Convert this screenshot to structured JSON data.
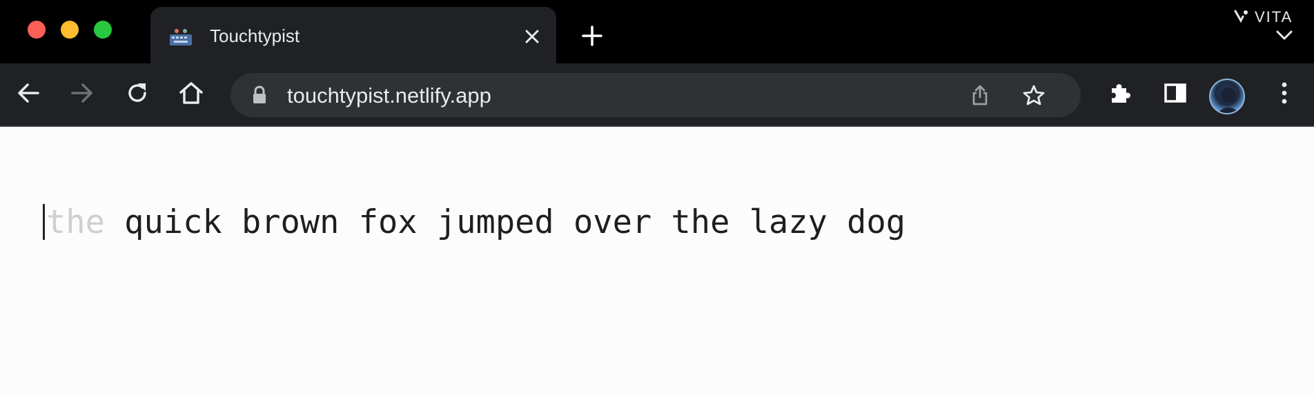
{
  "tab": {
    "title": "Touchtypist",
    "favicon": "keyboard-favicon-icon",
    "close_icon": "close-icon"
  },
  "new_tab_icon": "plus-icon",
  "brand": {
    "text": "VITA",
    "icon": "vita-logo-icon"
  },
  "tab_menu_icon": "chevron-down-icon",
  "toolbar": {
    "back_icon": "arrow-left-icon",
    "forward_icon": "arrow-right-icon",
    "reload_icon": "reload-icon",
    "home_icon": "home-icon",
    "extensions_icon": "puzzle-icon",
    "sidepanel_icon": "side-panel-icon",
    "profile_icon": "avatar",
    "menu_icon": "kebab-menu-icon"
  },
  "omnibox": {
    "url": "touchtypist.netlify.app",
    "lock_icon": "lock-icon",
    "share_icon": "share-icon",
    "bookmark_icon": "star-icon"
  },
  "typing": {
    "typed": "the",
    "remaining": " quick brown fox jumped over the lazy dog"
  },
  "colors": {
    "titlebar_bg": "#000000",
    "toolbar_bg": "#202124",
    "omnibox_bg": "#303134",
    "page_bg": "#fcfcfc",
    "typed_text": "#cfcfcf",
    "remaining_text": "#1e1e1e"
  }
}
